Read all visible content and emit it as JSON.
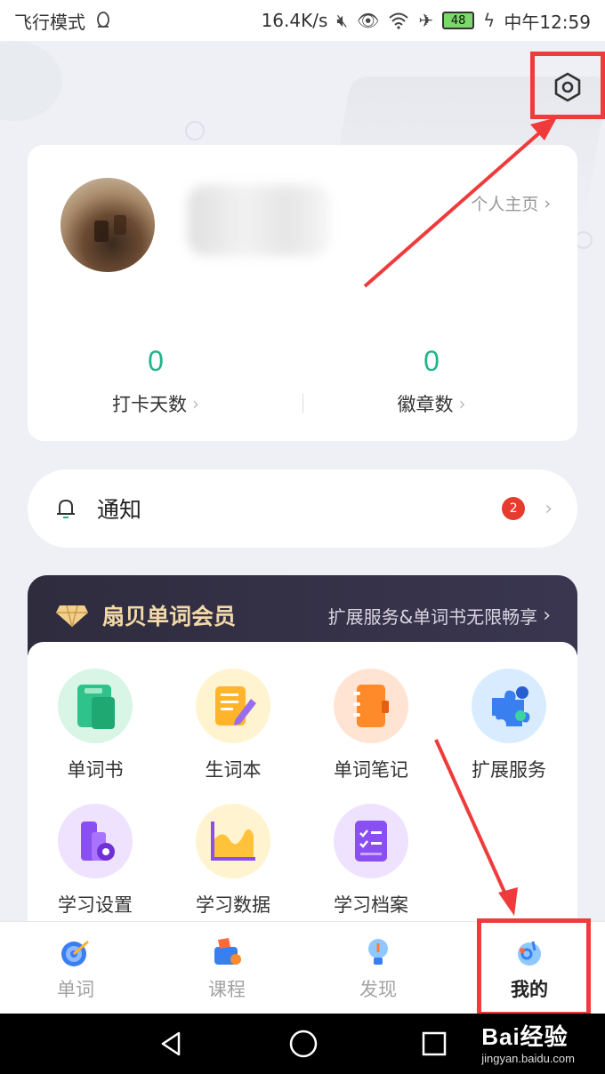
{
  "status_bar": {
    "left_text": "飞行模式",
    "net_speed": "16.4K/s",
    "battery": "48",
    "time": "中午12:59"
  },
  "profile": {
    "homepage_link": "个人主页",
    "stats": [
      {
        "value": "0",
        "label": "打卡天数"
      },
      {
        "value": "0",
        "label": "徽章数"
      }
    ]
  },
  "notification": {
    "title": "通知",
    "badge": "2"
  },
  "member": {
    "title": "扇贝单词会员",
    "subtitle": "扩展服务&单词书无限畅享"
  },
  "grid": [
    {
      "label": "单词书",
      "icon": "wordbook-icon"
    },
    {
      "label": "生词本",
      "icon": "new-words-notebook-icon"
    },
    {
      "label": "单词笔记",
      "icon": "word-notes-icon"
    },
    {
      "label": "扩展服务",
      "icon": "puzzle-icon"
    },
    {
      "label": "学习设置",
      "icon": "study-settings-icon"
    },
    {
      "label": "学习数据",
      "icon": "study-data-chart-icon"
    },
    {
      "label": "学习档案",
      "icon": "study-archive-icon"
    }
  ],
  "tabs": [
    {
      "label": "单词",
      "icon": "target-icon",
      "active": false
    },
    {
      "label": "课程",
      "icon": "course-icon",
      "active": false
    },
    {
      "label": "发现",
      "icon": "lightbulb-icon",
      "active": false
    },
    {
      "label": "我的",
      "icon": "ok-hand-icon",
      "active": true
    }
  ],
  "watermark": {
    "line1": "Bai经验",
    "line2": "jingyan.baidu.com"
  },
  "colors": {
    "accent_green": "#20b48c",
    "annotation_red": "#ef3b3b",
    "member_gold": "#f3d9a8",
    "badge_red": "#e83b2f"
  }
}
